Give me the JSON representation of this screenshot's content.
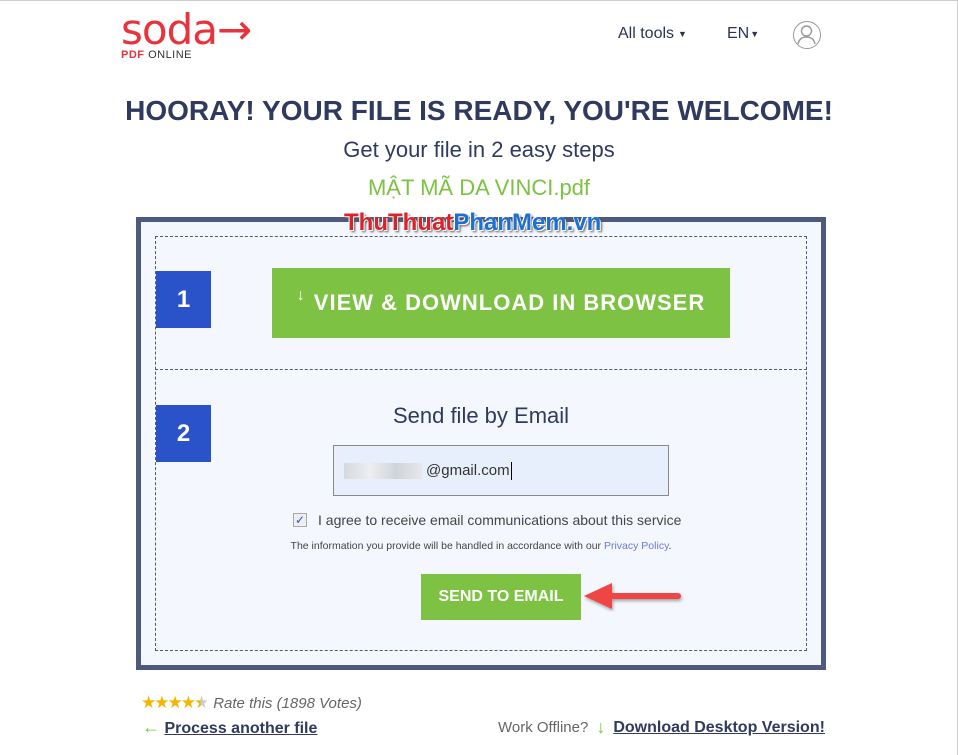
{
  "header": {
    "logo": "soda",
    "logo_sub_bold": "PDF",
    "logo_sub": "ONLINE",
    "all_tools": "All tools",
    "lang": "EN"
  },
  "title": "HOORAY! YOUR FILE IS READY, YOU'RE WELCOME!",
  "subtitle": "Get your file in 2 easy steps",
  "file_name": "MẬT MÃ DA VINCI.pdf",
  "watermark": {
    "a": "ThuThuat",
    "b": "PhanMem.vn"
  },
  "step1": {
    "number": "1",
    "button": "VIEW & DOWNLOAD IN BROWSER"
  },
  "step2": {
    "number": "2",
    "heading": "Send file by Email",
    "email_value": "@gmail.com",
    "agree": "I agree to receive email communications about this service",
    "agree_checked": true,
    "info": "The information you provide will be handled in accordance with our",
    "privacy": "Privacy Policy",
    "info_end": ".",
    "button": "SEND TO EMAIL"
  },
  "footer": {
    "rating": 4.5,
    "rate_text": "Rate this (1898 Votes)",
    "process": "Process another file",
    "offline": "Work Offline?",
    "download": "Download Desktop Version!"
  },
  "colors": {
    "brand": "#e8323c",
    "green": "#7dc242",
    "blue": "#2a52c9",
    "navy": "#2f3a5e",
    "arrow": "#f04444"
  }
}
